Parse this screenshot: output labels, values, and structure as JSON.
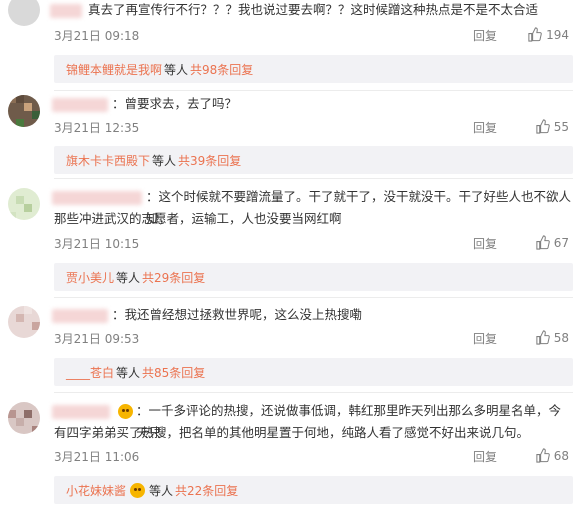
{
  "comments": [
    {
      "text": "真去了再宣传行不行？？？我也说过要去啊？？这时候蹭这种热点是不是不太合适",
      "date": "3月21日 09:18",
      "reply_label": "回复",
      "likes": "194",
      "sub_reply": {
        "name": "锦鲤本鲤就是我啊",
        "mid": "等人",
        "count": "共98条回复"
      }
    },
    {
      "text": "：曾要求去，去了吗？",
      "date": "3月21日 12:35",
      "reply_label": "回复",
      "likes": "55",
      "sub_reply": {
        "name": "旗木卡卡西殿下",
        "mid": "等人",
        "count": "共39条回复"
      }
    },
    {
      "text": "：这个时候就不要蹭流量了。干了就干了，没干就没干。干了好些人也不欲人知，",
      "text2": "那些冲进武汉的志愿者，运输工，人也没要当网红啊",
      "date": "3月21日 10:15",
      "reply_label": "回复",
      "likes": "67",
      "sub_reply": {
        "name": "贾小美儿",
        "mid": "等人",
        "count": "共29条回复"
      }
    },
    {
      "text": "：我还曾经想过拯救世界呢，这么没上热搜嘞",
      "date": "3月21日 09:53",
      "reply_label": "回复",
      "likes": "58",
      "sub_reply": {
        "name": "____苍白",
        "mid": "等人",
        "count": "共85条回复"
      }
    },
    {
      "text": "：一千多评论的热搜，还说做事低调，韩红那里昨天列出那么多明星名单，今天只",
      "text2": "有四字弟弟买了热搜，把名单的其他明星置于何地，纯路人看了感觉不好出来说几句。",
      "date": "3月21日 11:06",
      "reply_label": "回复",
      "likes": "68",
      "sub_reply": {
        "name": "小花妹妹酱",
        "mid": "等人",
        "count": "共22条回复"
      }
    }
  ]
}
